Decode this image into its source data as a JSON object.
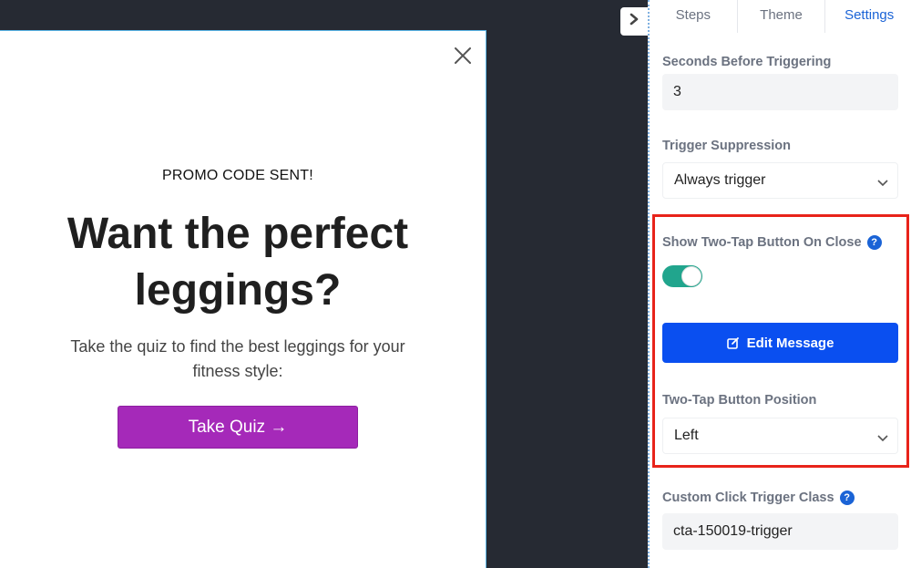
{
  "popup": {
    "promo_text": "PROMO CODE SENT!",
    "headline": "Want the perfect leggings?",
    "subtext": "Take the quiz to find the best leggings for your fitness style:",
    "cta_label": "Take Quiz →",
    "cta_color": "#a529b9"
  },
  "panel": {
    "tabs": [
      {
        "label": "Steps"
      },
      {
        "label": "Theme"
      },
      {
        "label": "Settings"
      }
    ],
    "active_tab": "Settings",
    "seconds_label": "Seconds Before Triggering",
    "seconds_value": "3",
    "suppression_label": "Trigger Suppression",
    "suppression_value": "Always trigger",
    "two_tap_label": "Show Two-Tap Button On Close",
    "two_tap_enabled": true,
    "edit_message_label": "Edit Message",
    "position_label": "Two-Tap Button Position",
    "position_value": "Left",
    "click_class_label": "Custom Click Trigger Class",
    "click_class_value": "cta-150019-trigger",
    "help_icon": "?"
  },
  "colors": {
    "accent_blue": "#0a4ff0",
    "toggle_on": "#21a58d",
    "highlight_red": "#e8231a"
  }
}
